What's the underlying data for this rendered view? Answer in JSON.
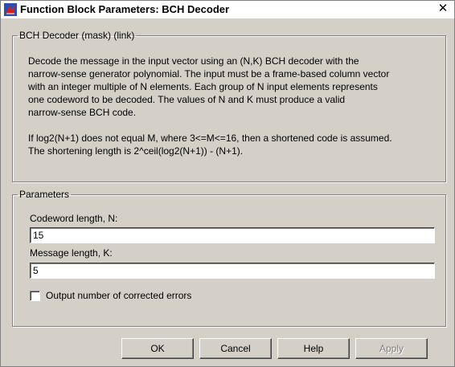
{
  "window": {
    "title": "Function Block Parameters: BCH Decoder",
    "close_glyph": "✕"
  },
  "description_group": {
    "legend": "BCH Decoder (mask) (link)",
    "lines": [
      "Decode the message in the input vector using an (N,K) BCH decoder with the",
      "narrow-sense generator polynomial.  The input must be a frame-based column vector",
      "with an integer multiple of N elements.  Each group of N input elements represents",
      "one codeword to be decoded.  The values of N and K must produce a valid",
      "narrow-sense BCH code.",
      "If log2(N+1) does not equal M, where 3<=M<=16, then a shortened code is assumed.",
      "The shortening length is 2^ceil(log2(N+1)) - (N+1)."
    ]
  },
  "parameters_group": {
    "legend": "Parameters",
    "codeword_label": "Codeword length, N:",
    "codeword_value": "15",
    "message_label": "Message length, K:",
    "message_value": "5",
    "checkbox_label": "Output number of corrected errors",
    "checkbox_checked": false
  },
  "buttons": {
    "ok": "OK",
    "cancel": "Cancel",
    "help": "Help",
    "apply": "Apply"
  },
  "colors": {
    "dialog_bg": "#d4d0c8",
    "icon_blue": "#2a4fb0",
    "icon_red": "#d02020"
  }
}
